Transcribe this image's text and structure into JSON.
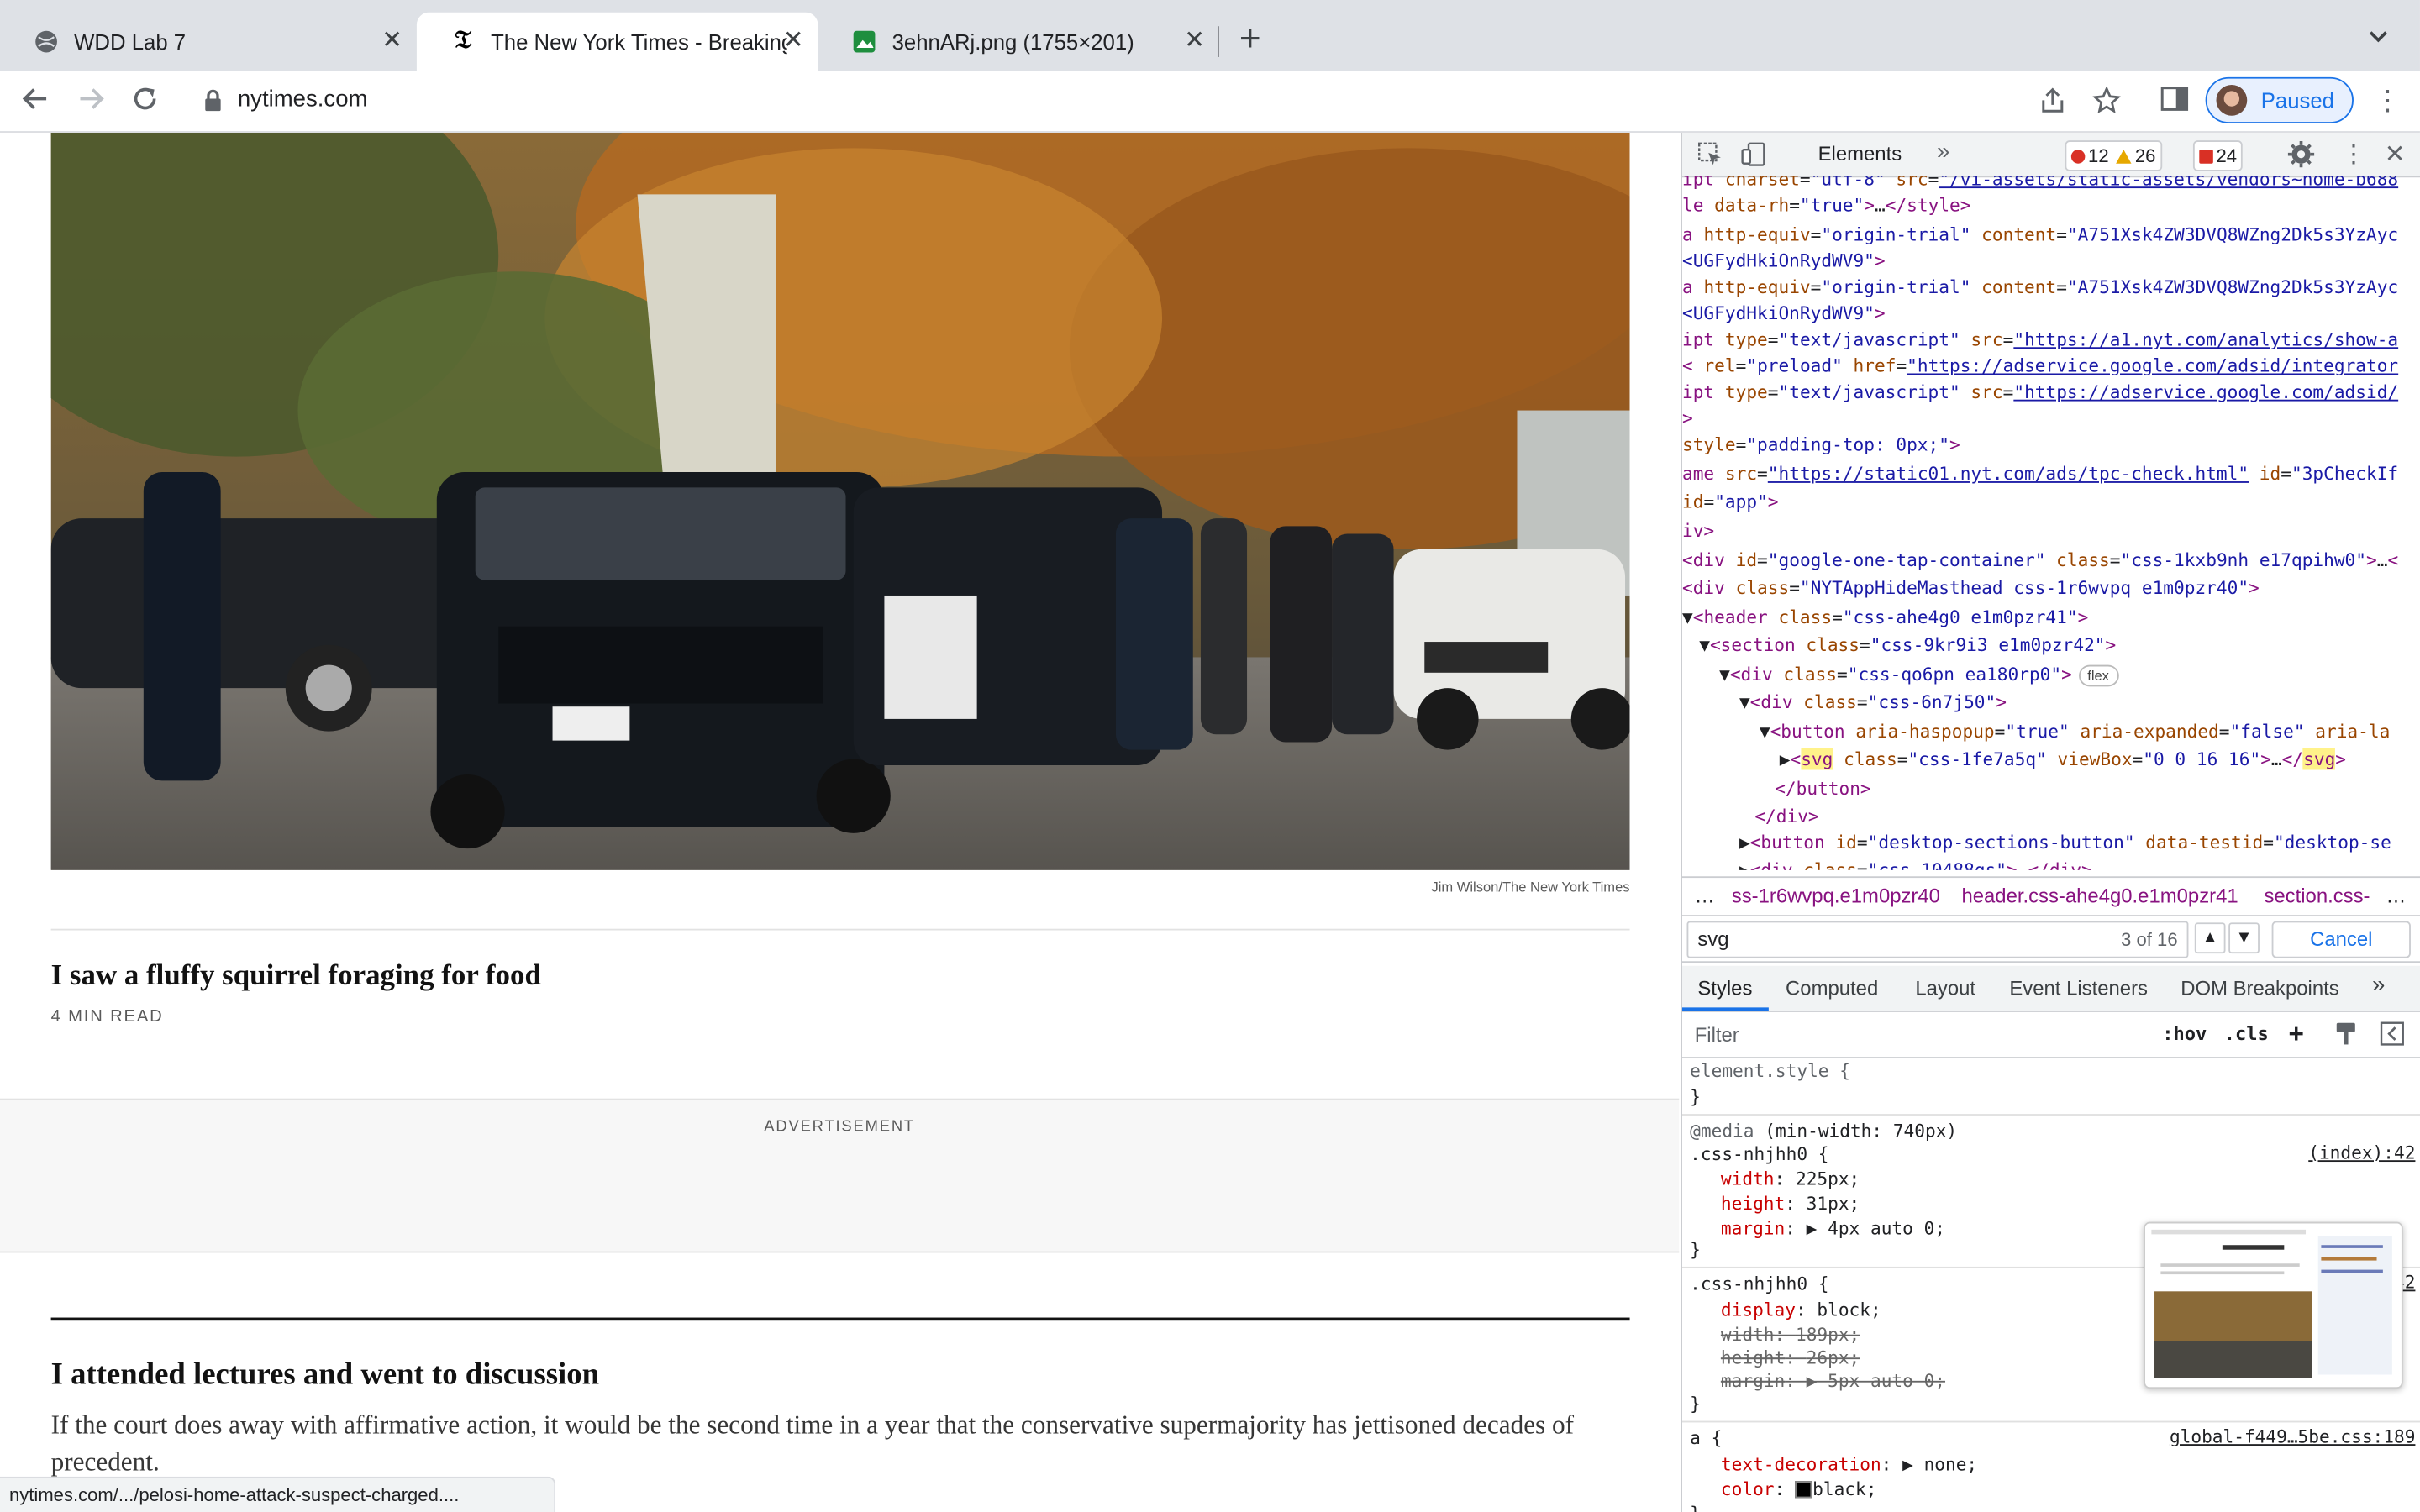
{
  "tabs": [
    {
      "title": "WDD Lab 7",
      "active": false
    },
    {
      "title": "The New York Times - Breaking",
      "active": true
    },
    {
      "title": "3ehnARj.png (1755×201)",
      "active": false
    }
  ],
  "toolbar": {
    "url": "nytimes.com",
    "profile_label": "Paused"
  },
  "article": {
    "photo_credit": "Jim Wilson/The New York Times",
    "headline1": "I saw a fluffy squirrel foraging for food",
    "read_time": "4 MIN READ",
    "ad_label": "ADVERTISEMENT",
    "headline2": "I attended lectures and went to discussion",
    "summary": "If the court does away with affirmative action, it would be the second time in a year that the conservative supermajority has jettisoned decades of precedent."
  },
  "status_url": "nytimes.com/.../pelosi-home-attack-suspect-charged....",
  "devtools": {
    "tab_elements": "Elements",
    "errors": "12",
    "warnings": "26",
    "issues": "24",
    "breadcrumbs": [
      "ss-1r6wvpq.e1m0pzr40",
      "header.css-ahe4g0.e1m0pzr41",
      "section.css-"
    ],
    "search_query": "svg",
    "search_count": "3 of 16",
    "cancel_label": "Cancel",
    "pane_tabs": [
      "Styles",
      "Computed",
      "Layout",
      "Event Listeners",
      "DOM Breakpoints"
    ],
    "filter_placeholder": "Filter",
    "hov": ":hov",
    "cls": ".cls",
    "dom_lines": [
      "ipt charset=\"utf-8\" src=\"/vi-assets/static-assets/vendors~home-b688",
      "le data-rh=\"true\">…</style>",
      "a http-equiv=\"origin-trial\" content=\"A751Xsk4ZW3DVQ8WZng2Dk5s3YzAyc",
      "<UGFydHkiOnRydWV9\">",
      "a http-equiv=\"origin-trial\" content=\"A751Xsk4ZW3DVQ8WZng2Dk5s3YzAyc",
      "<UGFydHkiOnRydWV9\">",
      "ipt type=\"text/javascript\" src=\"https://a1.nyt.com/analytics/show-a",
      "< rel=\"preload\" href=\"https://adservice.google.com/adsid/integrator",
      "ipt type=\"text/javascript\" src=\"https://adservice.google.com/adsid/",
      ">",
      "style=\"padding-top: 0px;\">",
      "ame src=\"https://static01.nyt.com/ads/tpc-check.html\" id=\"3pCheckIf",
      " id=\"app\">",
      "iv>",
      "<div id=\"google-one-tap-container\" class=\"css-1kxb9nh e17qpihw0\">…<",
      "<div class=\"NYTAppHideMasthead css-1r6wvpq e1m0pzr40\">",
      "▼<header class=\"css-ahe4g0 e1m0pzr41\">",
      "▼<section class=\"css-9kr9i3 e1m0pzr42\">",
      "▼<div class=\"css-qo6pn ea180rp0\">",
      "▼<div class=\"css-6n7j50\">",
      "▼<button aria-haspopup=\"true\" aria-expanded=\"false\" aria-la",
      "▶<svg class=\"css-1fe7a5q\" viewBox=\"0 0 16 16\">…</svg>",
      "</button>",
      "</div>",
      "▶<button id=\"desktop-sections-button\" data-testid=\"desktop-se",
      "▶<div class=\"css-10488qs\">…</div>"
    ],
    "flex_pill": "flex",
    "styles": {
      "element_style": "element.style {",
      "media": "@media",
      "media_query": "(min-width: 740px)",
      "rule1_selector": ".css-nhjhh0 {",
      "rule1_src": "(index):42",
      "rule1_props": [
        {
          "name": "width",
          "value": "225px;"
        },
        {
          "name": "height",
          "value": "31px;"
        },
        {
          "name": "margin",
          "value": "▶ 4px auto 0;"
        }
      ],
      "rule2_selector": ".css-nhjhh0 {",
      "rule2_src": "42",
      "rule2_props": [
        {
          "name": "display",
          "value": "block;",
          "strike": false
        },
        {
          "name": "width",
          "value": "189px;",
          "strike": true
        },
        {
          "name": "height",
          "value": "26px;",
          "strike": true
        },
        {
          "name": "margin",
          "value": "▶ 5px auto 0;",
          "strike": true
        }
      ],
      "rule3_selector": "a {",
      "rule3_src": "global-f449…5be.css:189",
      "rule3_props": [
        {
          "name": "text-decoration",
          "value": "▶ none;"
        },
        {
          "name": "color",
          "value": "black;"
        }
      ],
      "close_brace": "}"
    }
  },
  "colors": {
    "accent": "#1a73e8",
    "error": "#d93025",
    "warning": "#e6a800"
  }
}
